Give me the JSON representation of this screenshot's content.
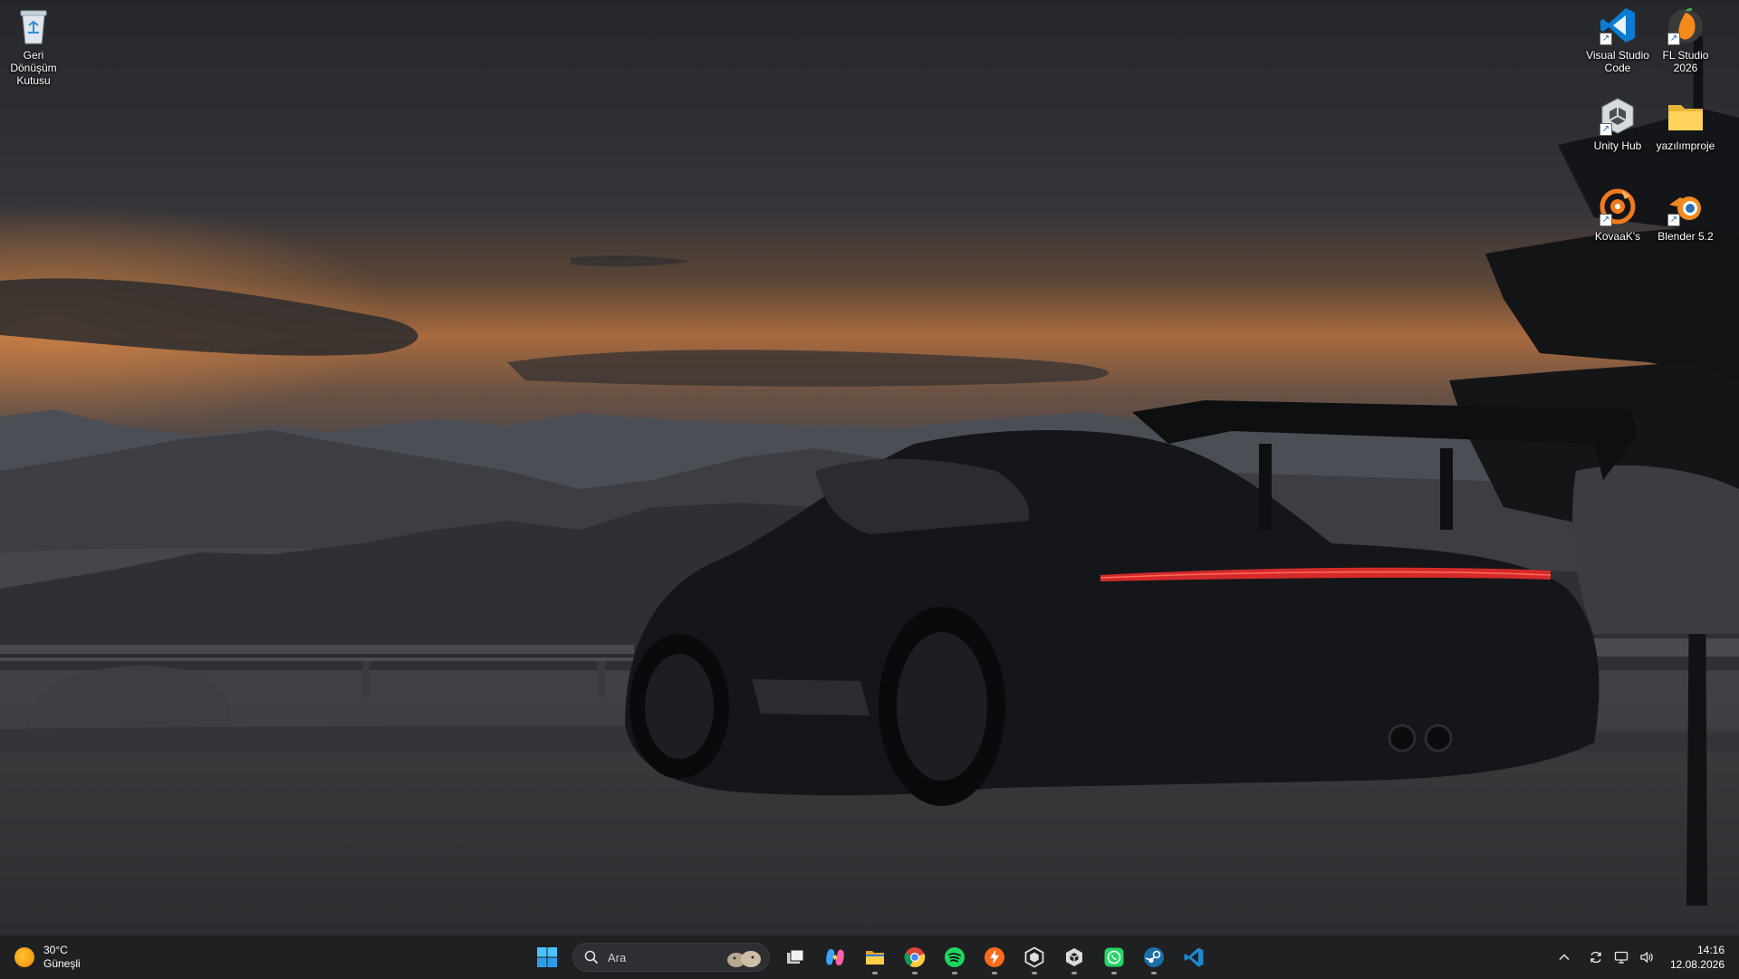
{
  "desktop": {
    "icons": [
      {
        "label": "Geri Dönüşüm Kutusu",
        "icon": "recycle-bin-icon"
      },
      {
        "label": "Visual Studio Code",
        "icon": "vscode-icon"
      },
      {
        "label": "FL Studio 2026",
        "icon": "fl-studio-icon"
      },
      {
        "label": "Unity Hub",
        "icon": "unity-hub-icon"
      },
      {
        "label": "yazılımproje",
        "icon": "folder-icon"
      },
      {
        "label": "KovaaK's",
        "icon": "kovaaks-icon"
      },
      {
        "label": "Blender 5.2",
        "icon": "blender-icon"
      }
    ]
  },
  "taskbar": {
    "weather": {
      "temperature": "30°C",
      "condition": "Güneşli",
      "icon": "sun-icon"
    },
    "search": {
      "placeholder": "Ara"
    },
    "apps": [
      {
        "name": "Start",
        "icon": "windows-start-icon"
      },
      {
        "name": "Task View",
        "icon": "task-view-icon"
      },
      {
        "name": "Copilot",
        "icon": "copilot-icon"
      },
      {
        "name": "File Explorer",
        "icon": "file-explorer-icon"
      },
      {
        "name": "Chrome",
        "icon": "chrome-icon"
      },
      {
        "name": "Spotify",
        "icon": "spotify-icon"
      },
      {
        "name": "Lightning app",
        "icon": "lightning-icon"
      },
      {
        "name": "Unity Hub",
        "icon": "unity-hub-icon"
      },
      {
        "name": "Unity",
        "icon": "unity-icon"
      },
      {
        "name": "WhatsApp",
        "icon": "whatsapp-icon"
      },
      {
        "name": "Steam",
        "icon": "steam-icon"
      },
      {
        "name": "Visual Studio Code",
        "icon": "vscode-icon"
      }
    ],
    "tray": {
      "time": "14:16",
      "date": "12.08.2026"
    }
  },
  "colors": {
    "taskbar_bg": "#1f2022",
    "accent_blue": "#0078d4",
    "sky_glow": "#c8763f"
  }
}
